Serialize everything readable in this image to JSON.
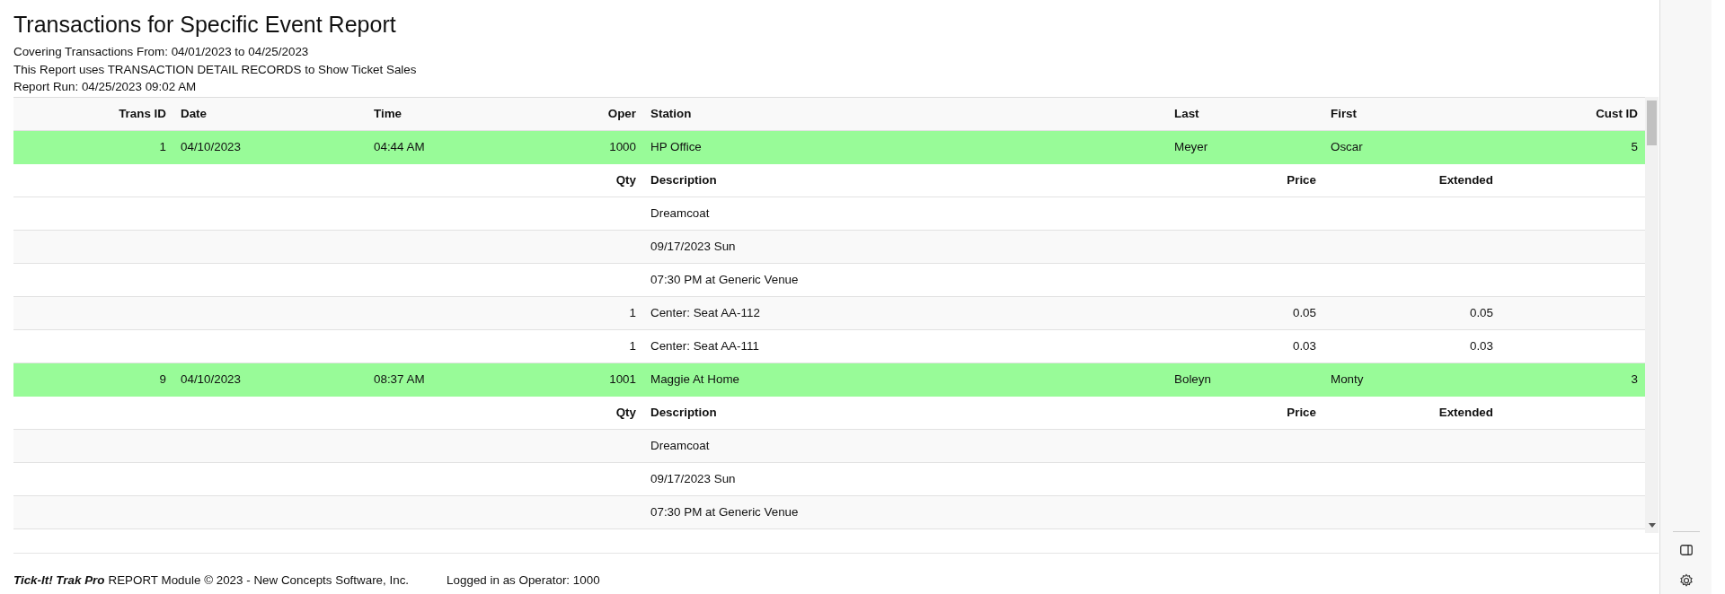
{
  "report": {
    "title": "Transactions for Specific Event Report",
    "lines": [
      "Covering Transactions From: 04/01/2023 to 04/25/2023",
      "This Report uses TRANSACTION DETAIL RECORDS to Show Ticket Sales",
      "Report Run: 04/25/2023 09:02 AM"
    ]
  },
  "table": {
    "columns": [
      "Trans ID",
      "Date",
      "Time",
      "Oper",
      "Station",
      "Last",
      "First",
      "Cust ID"
    ],
    "transactions": [
      {
        "trans_id": "1",
        "date": "04/10/2023",
        "time": "04:44 AM",
        "oper": "1000",
        "station": "HP Office",
        "last": "Meyer",
        "first": "Oscar",
        "cust_id": "5",
        "detail_columns": [
          "Qty",
          "Description",
          "Price",
          "Extended"
        ],
        "details": [
          {
            "description": "Dreamcoat"
          },
          {
            "description": "09/17/2023 Sun"
          },
          {
            "description": "07:30 PM at Generic Venue"
          },
          {
            "qty": "1",
            "description": "Center: Seat AA-112",
            "price": "0.05",
            "extended": "0.05"
          },
          {
            "qty": "1",
            "description": "Center: Seat AA-111",
            "price": "0.03",
            "extended": "0.03"
          }
        ]
      },
      {
        "trans_id": "9",
        "date": "04/10/2023",
        "time": "08:37 AM",
        "oper": "1001",
        "station": "Maggie At Home",
        "last": "Boleyn",
        "first": "Monty",
        "cust_id": "3",
        "detail_columns": [
          "Qty",
          "Description",
          "Price",
          "Extended"
        ],
        "details": [
          {
            "description": "Dreamcoat"
          },
          {
            "description": "09/17/2023 Sun"
          },
          {
            "description": "07:30 PM at Generic Venue"
          }
        ]
      }
    ]
  },
  "footer": {
    "brand": "Tick-It! Trak Pro",
    "module": "REPORT Module © 2023 - New Concepts Software, Inc.",
    "operator": "Logged in as Operator: 1000"
  }
}
